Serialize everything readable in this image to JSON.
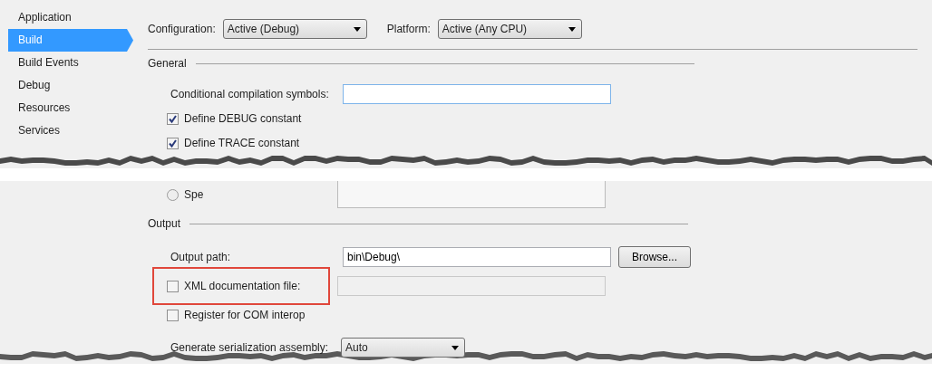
{
  "sidebar": {
    "items": [
      {
        "label": "Application",
        "selected": false
      },
      {
        "label": "Build",
        "selected": true
      },
      {
        "label": "Build Events",
        "selected": false
      },
      {
        "label": "Debug",
        "selected": false
      },
      {
        "label": "Resources",
        "selected": false
      },
      {
        "label": "Services",
        "selected": false
      }
    ]
  },
  "toolbar": [
    {
      "label": "Configuration:",
      "value": "Active (Debug)"
    },
    {
      "label": "Platform:",
      "value": "Active (Any CPU)"
    }
  ],
  "general": {
    "title": "General",
    "rows": [
      {
        "kind": "text",
        "label": "Conditional compilation symbols:",
        "value": "",
        "focused": true
      },
      {
        "kind": "checkbox",
        "label": "Define DEBUG constant",
        "checked": true
      },
      {
        "kind": "checkbox",
        "label": "Define TRACE constant",
        "checked": true
      }
    ]
  },
  "errors": {
    "rows": [
      {
        "kind": "radio",
        "label": "Spe",
        "selected": false
      }
    ]
  },
  "output": {
    "title": "Output",
    "rows": [
      {
        "kind": "text",
        "label": "Output path:",
        "value": "bin\\Debug\\",
        "button": "Browse..."
      },
      {
        "kind": "checkbox-text",
        "label": "XML documentation file:",
        "checked": false,
        "highlighted": true,
        "disabled": true
      },
      {
        "kind": "checkbox",
        "label": "Register for COM interop",
        "checked": false
      },
      {
        "kind": "select",
        "label": "Generate serialization assembly:",
        "value": "Auto"
      }
    ]
  }
}
